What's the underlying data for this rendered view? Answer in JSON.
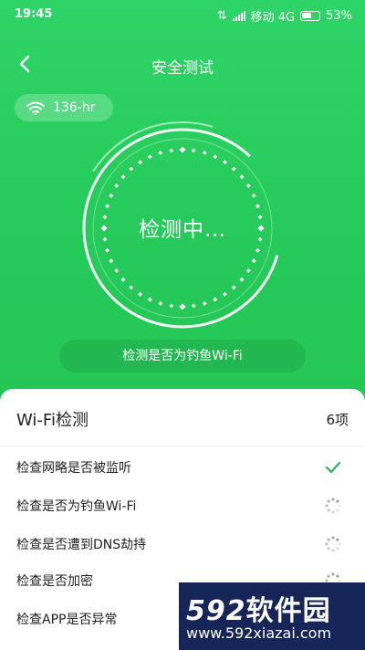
{
  "status_bar": {
    "time": "19:45",
    "carrier": "移动 4G",
    "battery_percent": "53%"
  },
  "header": {
    "title": "安全测试"
  },
  "wifi": {
    "name": "136-hr"
  },
  "dial": {
    "status_text": "检测中…"
  },
  "current_check": "检测是否为钓鱼Wi-Fi",
  "checklist": {
    "title": "Wi-Fi检测",
    "count": "6项",
    "items": [
      {
        "label": "检查网略是否被监听",
        "status": "done"
      },
      {
        "label": "检查是否为钓鱼Wi-Fi",
        "status": "loading"
      },
      {
        "label": "检查是否遭到DNS劫持",
        "status": "loading"
      },
      {
        "label": "检查是否加密",
        "status": "loading"
      },
      {
        "label": "检查APP是否异常",
        "status": "loading"
      }
    ]
  },
  "watermark": {
    "brand_number": "592",
    "brand_text": "软件园",
    "url": "www.592xiazai.com"
  },
  "colors": {
    "primary_green": "#27cb5b",
    "check_green": "#27b45a",
    "watermark_bg": "#172658"
  }
}
